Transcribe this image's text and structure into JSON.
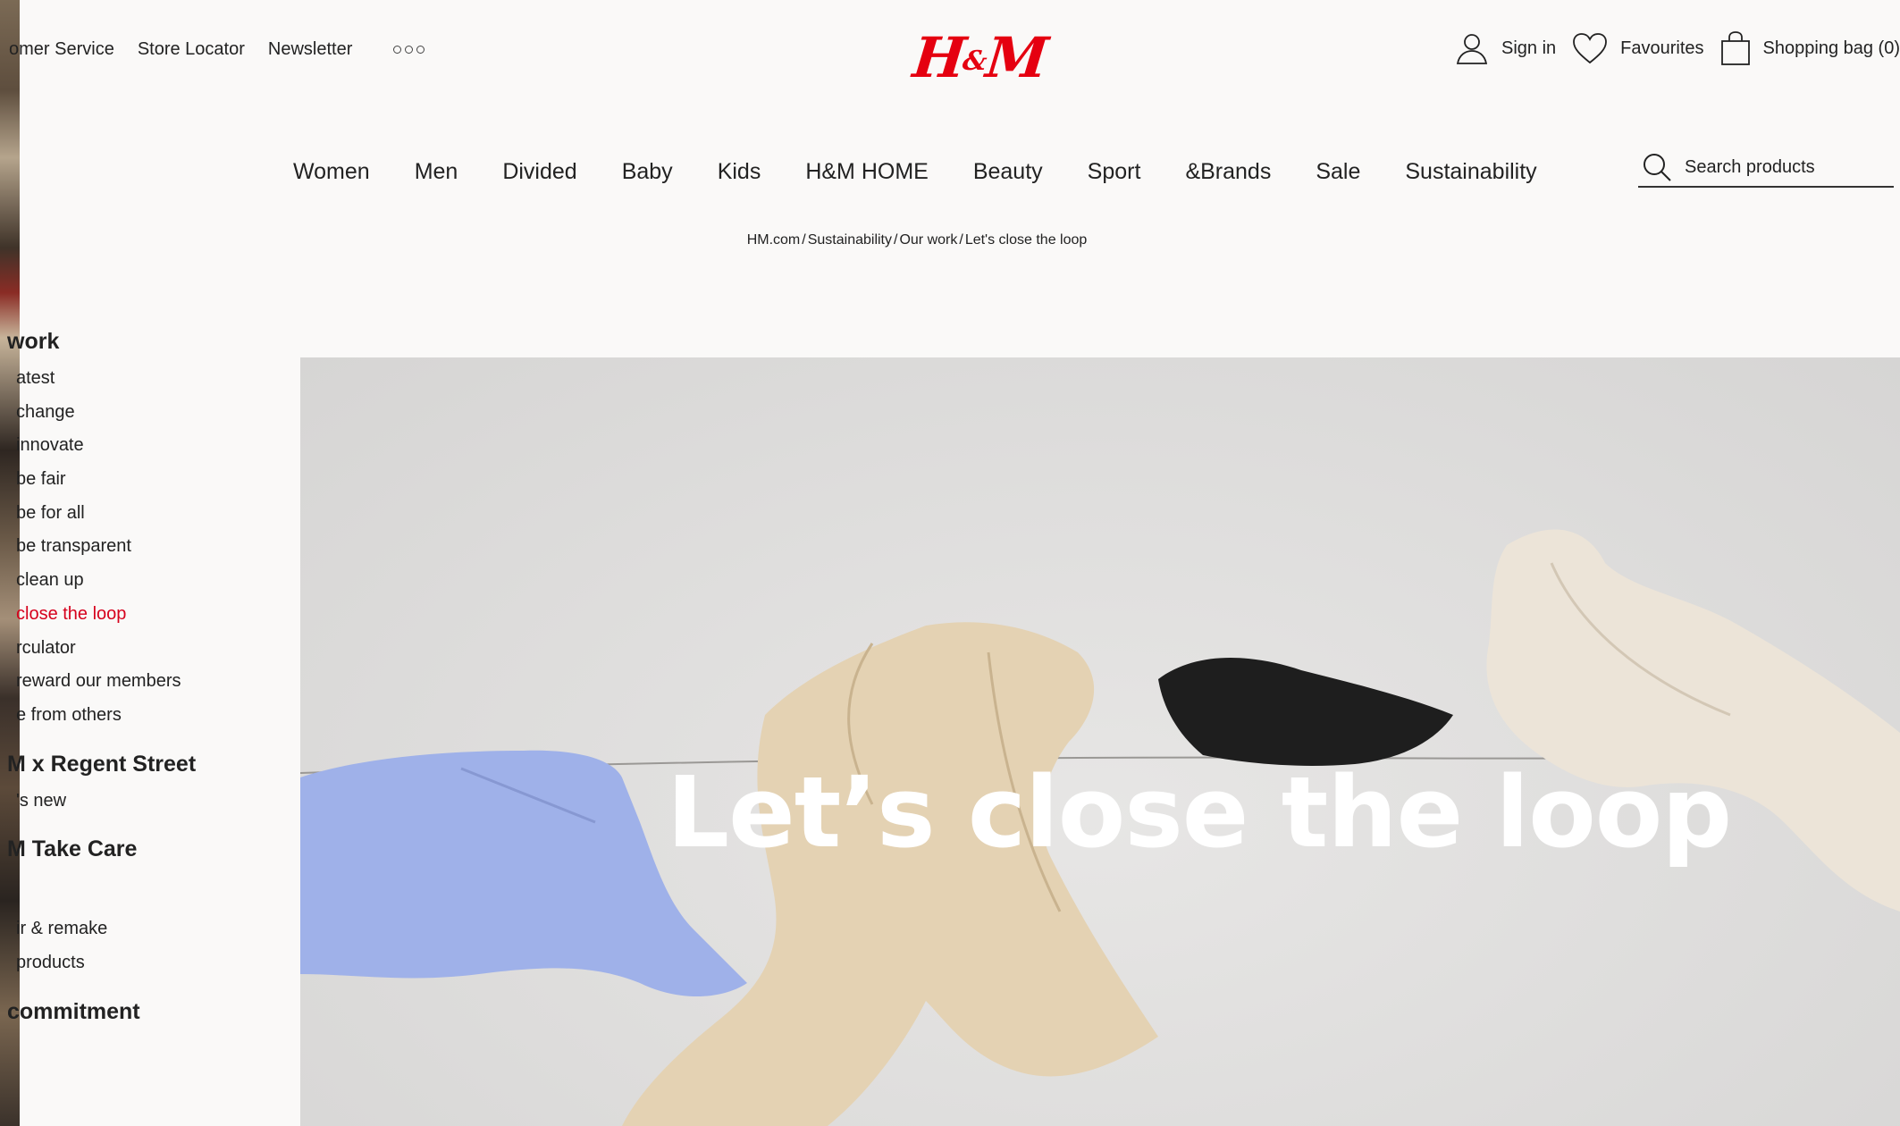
{
  "utility_nav": {
    "links": [
      "omer Service",
      "Store Locator",
      "Newsletter"
    ],
    "more_icon": "more-dots-icon"
  },
  "brand": {
    "logo_text": "H&M",
    "logo_color": "#e50010"
  },
  "account": {
    "sign_in": "Sign in",
    "favourites": "Favourites",
    "shopping_bag": "Shopping bag (0)"
  },
  "main_nav": [
    "Women",
    "Men",
    "Divided",
    "Baby",
    "Kids",
    "H&M HOME",
    "Beauty",
    "Sport",
    "&Brands",
    "Sale",
    "Sustainability"
  ],
  "search": {
    "placeholder": "Search products"
  },
  "breadcrumb": [
    "HM.com",
    "Sustainability",
    "Our work",
    "Let's close the loop"
  ],
  "sidebar": {
    "section1_heading": "work",
    "section1_items": [
      "atest",
      "change",
      "innovate",
      "be fair",
      "be for all",
      "be transparent",
      "clean up",
      "close the loop",
      "rculator",
      "reward our members",
      "e from others"
    ],
    "active_item": "close the loop",
    "section2_heading": "M x Regent Street",
    "section2_items": [
      "'s new"
    ],
    "section3_heading": "M Take Care",
    "section3_items": [
      "ir & remake",
      "products"
    ],
    "section4_heading": "commitment"
  },
  "hero": {
    "title": "Let’s close the loop"
  },
  "colors": {
    "accent_red": "#d6001c",
    "background": "#faf9f8"
  }
}
